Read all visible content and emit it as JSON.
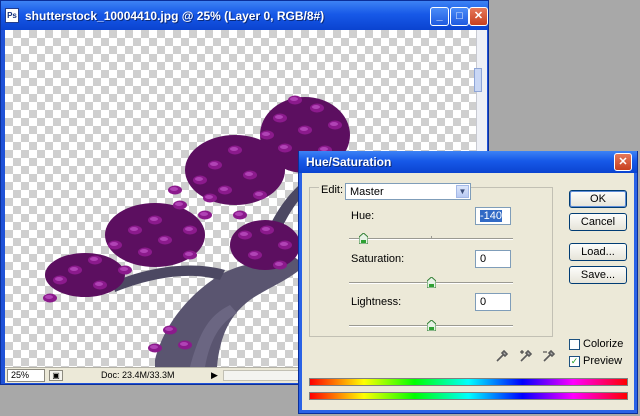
{
  "document": {
    "title": "shutterstock_10004410.jpg @ 25% (Layer 0, RGB/8#)",
    "icon": "ps-icon",
    "controls": {
      "minimize": "_",
      "maximize": "□",
      "close": "✕"
    },
    "status": {
      "zoom": "25%",
      "info": "Doc: 23.4M/33.3M"
    }
  },
  "dialog": {
    "title": "Hue/Saturation",
    "close_glyph": "✕",
    "edit_label": "Edit:",
    "edit_value": "Master",
    "hue": {
      "label": "Hue:",
      "value": "-140"
    },
    "saturation": {
      "label": "Saturation:",
      "value": "0"
    },
    "lightness": {
      "label": "Lightness:",
      "value": "0"
    },
    "buttons": {
      "ok": "OK",
      "cancel": "Cancel",
      "load": "Load...",
      "save": "Save..."
    },
    "colorize": {
      "label": "Colorize",
      "checked": false
    },
    "preview": {
      "label": "Preview",
      "checked": true,
      "mark": "✓"
    },
    "eyedroppers": [
      "eyedropper-icon",
      "eyedropper-plus-icon",
      "eyedropper-minus-icon"
    ]
  },
  "colors": {
    "title_bar": "#1759e8",
    "foliage": "#8b1a8c",
    "trunk": "#5a5570"
  }
}
